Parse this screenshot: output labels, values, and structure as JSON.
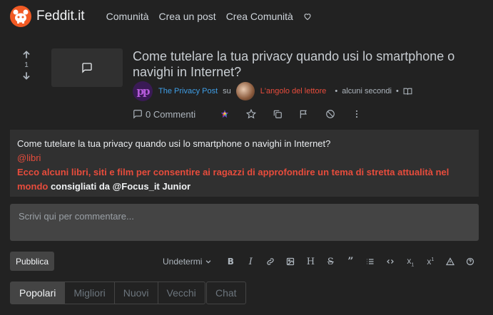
{
  "navbar": {
    "brand": "Feddit.it",
    "links": [
      "Comunità",
      "Crea un post",
      "Crea Comunità"
    ],
    "brand_color": "#f15a24"
  },
  "post": {
    "score": "1",
    "title": "Come tutelare la tua privacy quando usi lo smartphone o navighi in Internet?",
    "author": "The Privacy Post",
    "on": "su",
    "community": "L'angolo del lettore",
    "time": "alcuni secondi",
    "comments": "0 Commenti"
  },
  "body": {
    "line1": "Come tutelare la tua privacy quando usi lo smartphone o navighi in Internet?",
    "mention": "@libri",
    "highlight": "Ecco alcuni libri, siti e film per consentire ai ragazzi di approfondire un tema di stretta attualità nel mondo",
    "suffix": " consigliati da @Focus_it Junior"
  },
  "comment": {
    "placeholder": "Scrivi qui per commentare...",
    "publish": "Pubblica",
    "language": "Undetermi"
  },
  "tabs": [
    "Popolari",
    "Migliori",
    "Nuovi",
    "Vecchi"
  ],
  "chat": "Chat",
  "colors": {
    "background": "#222222",
    "card": "#303030",
    "accent_red": "#e74c3c",
    "link_blue": "#3f9ee6"
  }
}
